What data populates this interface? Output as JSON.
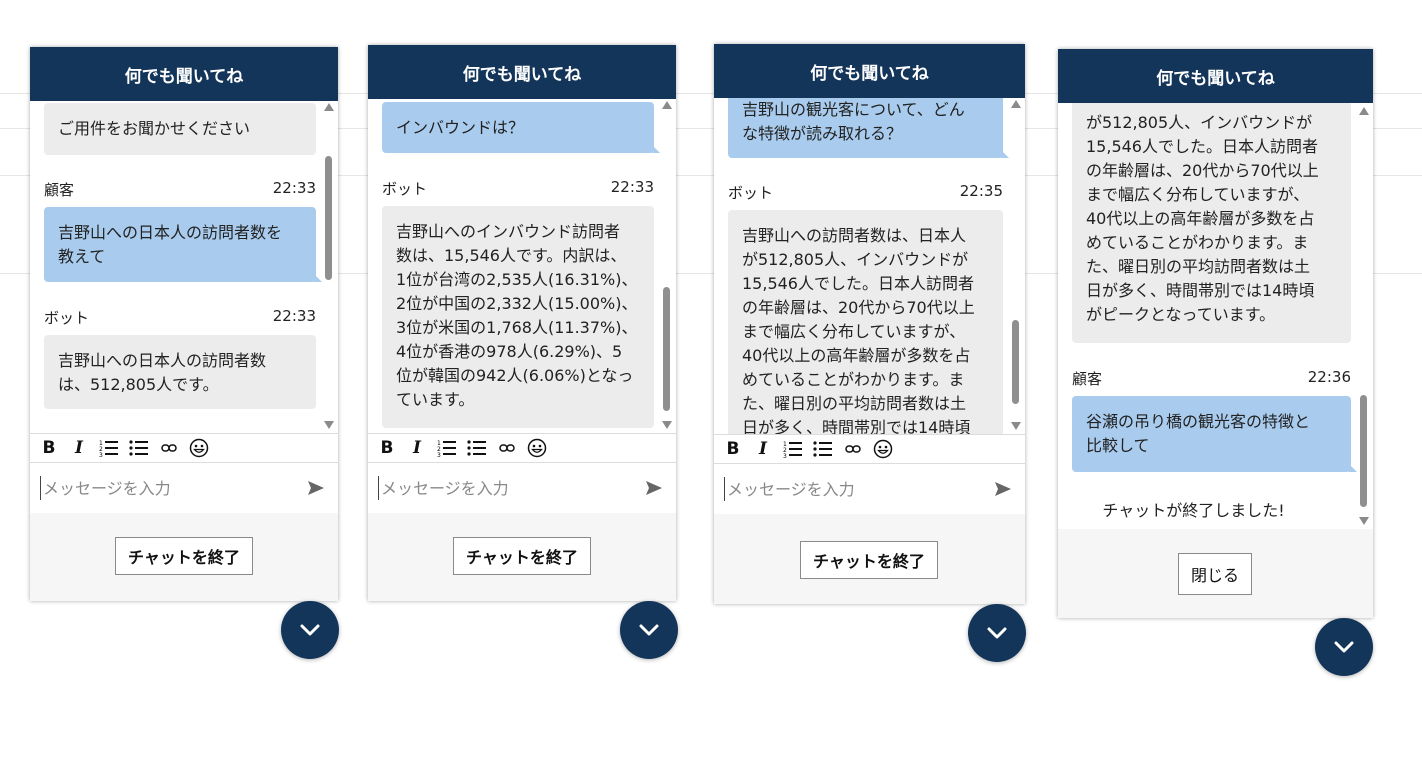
{
  "header_title": "何でも聞いてね",
  "input_placeholder": "メッセージを入力",
  "end_chat_label": "チャットを終了",
  "close_label": "閉じる",
  "chat_ended_text": "チャットが終了しました!",
  "colors": {
    "header": "#13355a",
    "bot_bubble": "#ececec",
    "customer_bubble": "#a9ccee",
    "fab": "#13355a"
  },
  "toolbar_icons": [
    "bold-icon",
    "italic-icon",
    "ordered-list-icon",
    "bullet-list-icon",
    "link-icon",
    "emoji-icon"
  ],
  "panels": [
    {
      "messages": [
        {
          "sender": "",
          "time": "",
          "role": "bot",
          "text": "ご用件をお聞かせください"
        },
        {
          "sender": "顧客",
          "time": "22:33",
          "role": "customer",
          "text": "吉野山への日本人の訪問者数を\n教えて"
        },
        {
          "sender": "ボット",
          "time": "22:33",
          "role": "bot",
          "text": "吉野山への日本人の訪問者数\nは、512,805人です。"
        }
      ]
    },
    {
      "messages": [
        {
          "sender": "",
          "time": "",
          "role": "customer",
          "text": "インバウンドは？"
        },
        {
          "sender": "ボット",
          "time": "22:33",
          "role": "bot",
          "text": "吉野山へのインバウンド訪問者\n数は、15,546人です。内訳は、\n1位が台湾の2,535人(16.31%)、\n2位が中国の2,332人(15.00%)、\n3位が米国の1,768人(11.37%)、\n4位が香港の978人(6.29%)、5\n位が韓国の942人(6.06%)となっ\nています。"
        }
      ]
    },
    {
      "messages": [
        {
          "sender": "",
          "time": "",
          "role": "customer",
          "text": "吉野山の観光客について、どん\nな特徴が読み取れる？"
        },
        {
          "sender": "ボット",
          "time": "22:35",
          "role": "bot",
          "text": "吉野山への訪問者数は、日本人\nが512,805人、インバウンドが\n15,546人でした。日本人訪問者\nの年齢層は、20代から70代以上\nまで幅広く分布していますが、\n40代以上の高年齢層が多数を占\nめていることがわかります。ま\nた、曜日別の平均訪問者数は土\n日が多く、時間帯別では14時頃"
        }
      ]
    },
    {
      "messages": [
        {
          "sender": "",
          "time": "",
          "role": "bot",
          "text": "が512,805人、インバウンドが\n15,546人でした。日本人訪問者\nの年齢層は、20代から70代以上\nまで幅広く分布していますが、\n40代以上の高年齢層が多数を占\nめていることがわかります。ま\nた、曜日別の平均訪問者数は土\n日が多く、時間帯別では14時頃\nがピークとなっています。"
        },
        {
          "sender": "顧客",
          "time": "22:36",
          "role": "customer",
          "text": "谷瀬の吊り橋の観光客の特徴と\n比較して"
        }
      ]
    }
  ]
}
